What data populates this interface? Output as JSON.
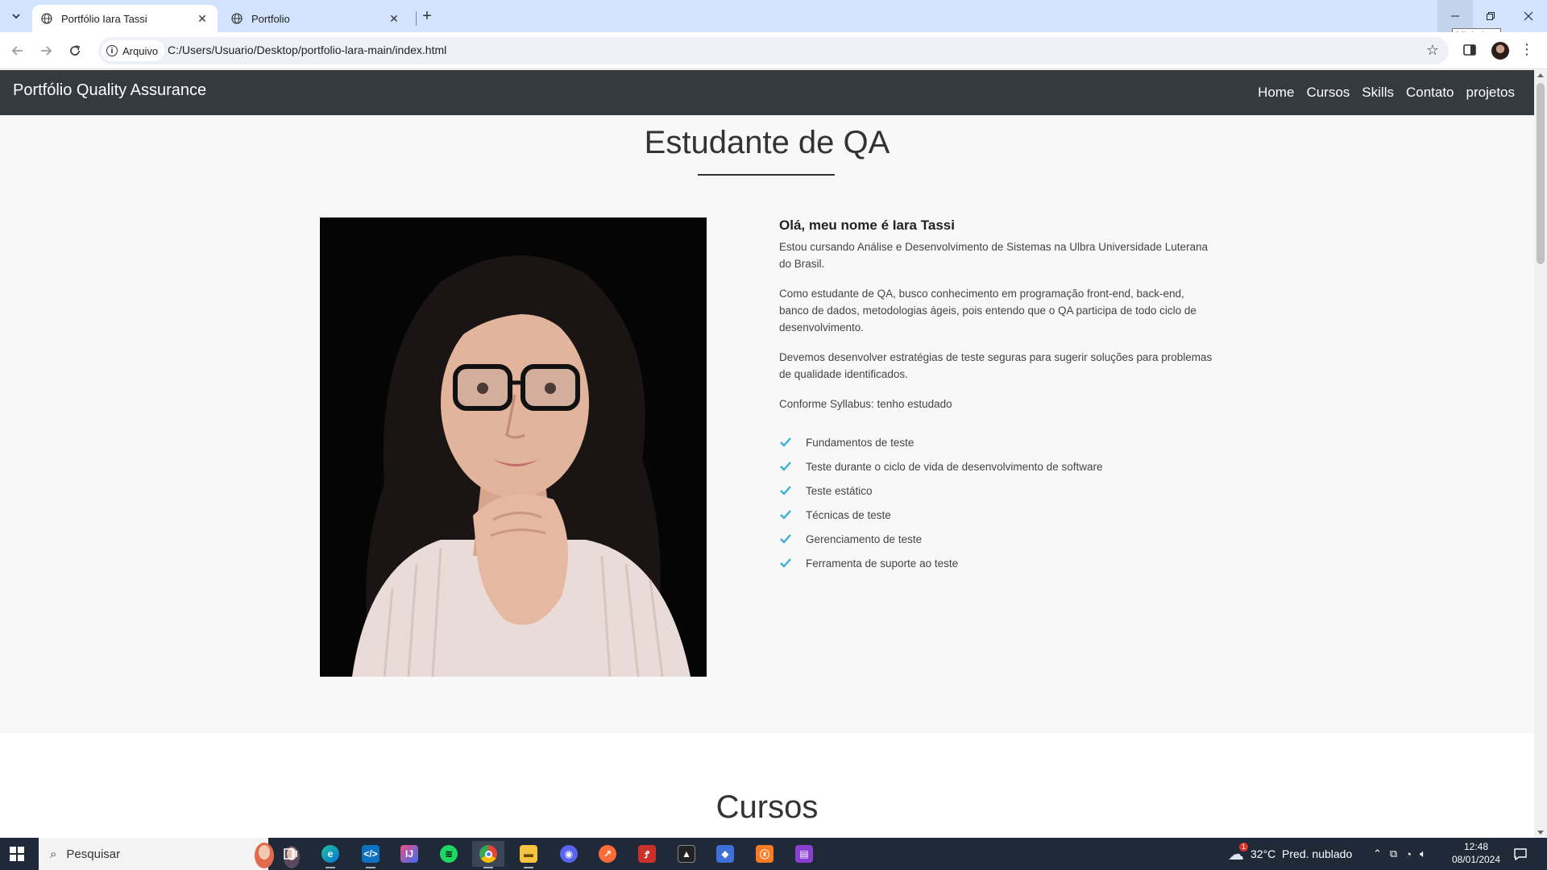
{
  "browser": {
    "tabs": [
      {
        "title": "Portfólio Iara Tassi",
        "active": true
      },
      {
        "title": "Portfolio",
        "active": false
      }
    ],
    "tooltip": "Minimizar",
    "security_chip": "Arquivo",
    "url": "C:/Users/Usuario/Desktop/portfolio-lara-main/index.html"
  },
  "navbar": {
    "brand": "Portfólio Quality Assurance",
    "links": [
      "Home",
      "Cursos",
      "Skills",
      "Contato",
      "projetos"
    ]
  },
  "about": {
    "title": "Estudante de QA",
    "heading": "Olá, meu nome é Iara Tassi",
    "paragraphs": [
      "Estou cursando Análise e Desenvolvimento de Sistemas na Ulbra Universidade Luterana do Brasil.",
      "Como estudante de QA, busco conhecimento em programação front-end, back-end, banco de dados, metodologias ágeis, pois entendo que o QA participa de todo ciclo de desenvolvimento.",
      "Devemos desenvolver estratégias de teste seguras para sugerir soluções para problemas de qualidade identificados.",
      "Conforme Syllabus: tenho estudado"
    ],
    "checklist": [
      "Fundamentos de teste",
      "Teste durante o ciclo de vida de desenvolvimento de software",
      "Teste estático",
      "Técnicas de teste",
      "Gerenciamento de teste",
      "Ferramenta de suporte ao teste"
    ]
  },
  "cursos": {
    "title": "Cursos"
  },
  "taskbar": {
    "search_placeholder": "Pesquisar",
    "weather": "32°C  Pred. nublado",
    "weather_badge": "1",
    "time": "12:48",
    "date": "08/01/2024"
  },
  "colors": {
    "navbar_bg": "#343a40",
    "check_icon": "#3ab0d6",
    "tab_strip": "#d3e3fd",
    "taskbar_bg": "#1f2937"
  }
}
